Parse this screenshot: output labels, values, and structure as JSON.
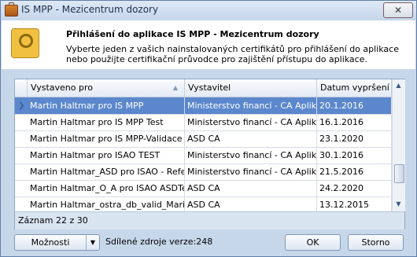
{
  "window": {
    "title": "IS MPP - Mezicentrum dozory",
    "close_symbol": "✕",
    "app_icon": "briefcase-icon"
  },
  "header": {
    "title": "Přihlášení do aplikace  IS MPP - Mezicentrum dozory",
    "description_line1": "Vyberte jeden z vašich nainstalovaných certifikátů pro přihlášení do aplikace",
    "description_line2": "nebo použijte certifikační průvodce pro zajištění přístupu do aplikace.",
    "icon": "certificate-keys-icon"
  },
  "grid": {
    "columns": [
      "Vystaveno pro",
      "Vystavitel",
      "Datum vypršení"
    ],
    "sort_indicator": "▲",
    "rows": [
      {
        "issued_to": "Martin Haltmar pro IS MPP",
        "issuer": "Ministerstvo financí - CA Aplikace",
        "expiry": "20.1.2016",
        "selected": true
      },
      {
        "issued_to": "Martin Haltmar pro IS MPP Test",
        "issuer": "Ministerstvo financí - CA Aplikace",
        "expiry": "16.1.2016"
      },
      {
        "issued_to": "Martin Haltmar pro IS MPP-Validace",
        "issuer": "ASD CA",
        "expiry": "23.1.2020"
      },
      {
        "issued_to": "Martin Haltmar pro ISAO TEST",
        "issuer": "Ministerstvo financí - CA Aplikace",
        "expiry": "30.1.2016"
      },
      {
        "issued_to": "Martin Haltmar_ASD pro ISAO - Refer...",
        "issuer": "Ministerstvo financí - CA Aplikace",
        "expiry": "21.5.2016"
      },
      {
        "issued_to": "Martin Haltmar_O_A pro ISAO ASDTest",
        "issuer": "ASD CA",
        "expiry": "24.2.2020"
      },
      {
        "issued_to": "Martin Haltmar_ostra_db_valid_Marie...",
        "issuer": "ASD CA",
        "expiry": "13.12.2015"
      }
    ],
    "footer": "Záznam 22 z 30"
  },
  "buttons": {
    "options": "Možnosti",
    "ok": "OK",
    "cancel": "Storno"
  },
  "version_text": "Sdílené zdroje verze:248"
}
